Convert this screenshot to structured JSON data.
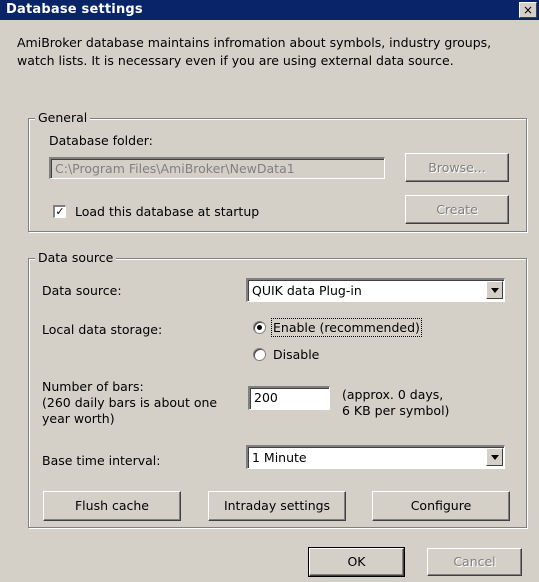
{
  "window": {
    "title": "Database settings",
    "close_glyph": "×"
  },
  "intro": "AmiBroker database maintains infromation about symbols, industry groups, watch lists. It is necessary even if you are using external data source.",
  "general": {
    "legend": "General",
    "folder_label": "Database folder:",
    "folder_value": "C:\\Program Files\\AmiBroker\\NewData1",
    "browse_label": "Browse...",
    "load_startup_label": "Load this database at startup",
    "load_startup_checked": true,
    "create_label": "Create"
  },
  "data_source": {
    "legend": "Data source",
    "source_label": "Data source:",
    "source_value": "QUIK data Plug-in",
    "storage_label": "Local data storage:",
    "enable_label": "Enable (recommended)",
    "disable_label": "Disable",
    "storage_selected": "enable",
    "bars_label_1": "Number of bars:",
    "bars_label_2": "(260 daily bars is about one",
    "bars_label_3": "year worth)",
    "bars_value": "200",
    "approx_1": "(approx. 0 days,",
    "approx_2": "6 KB per symbol)",
    "interval_label": "Base time interval:",
    "interval_value": "1 Minute",
    "flush_label": "Flush cache",
    "intraday_label": "Intraday settings",
    "configure_label": "Configure"
  },
  "footer": {
    "ok_label": "OK",
    "cancel_label": "Cancel"
  }
}
